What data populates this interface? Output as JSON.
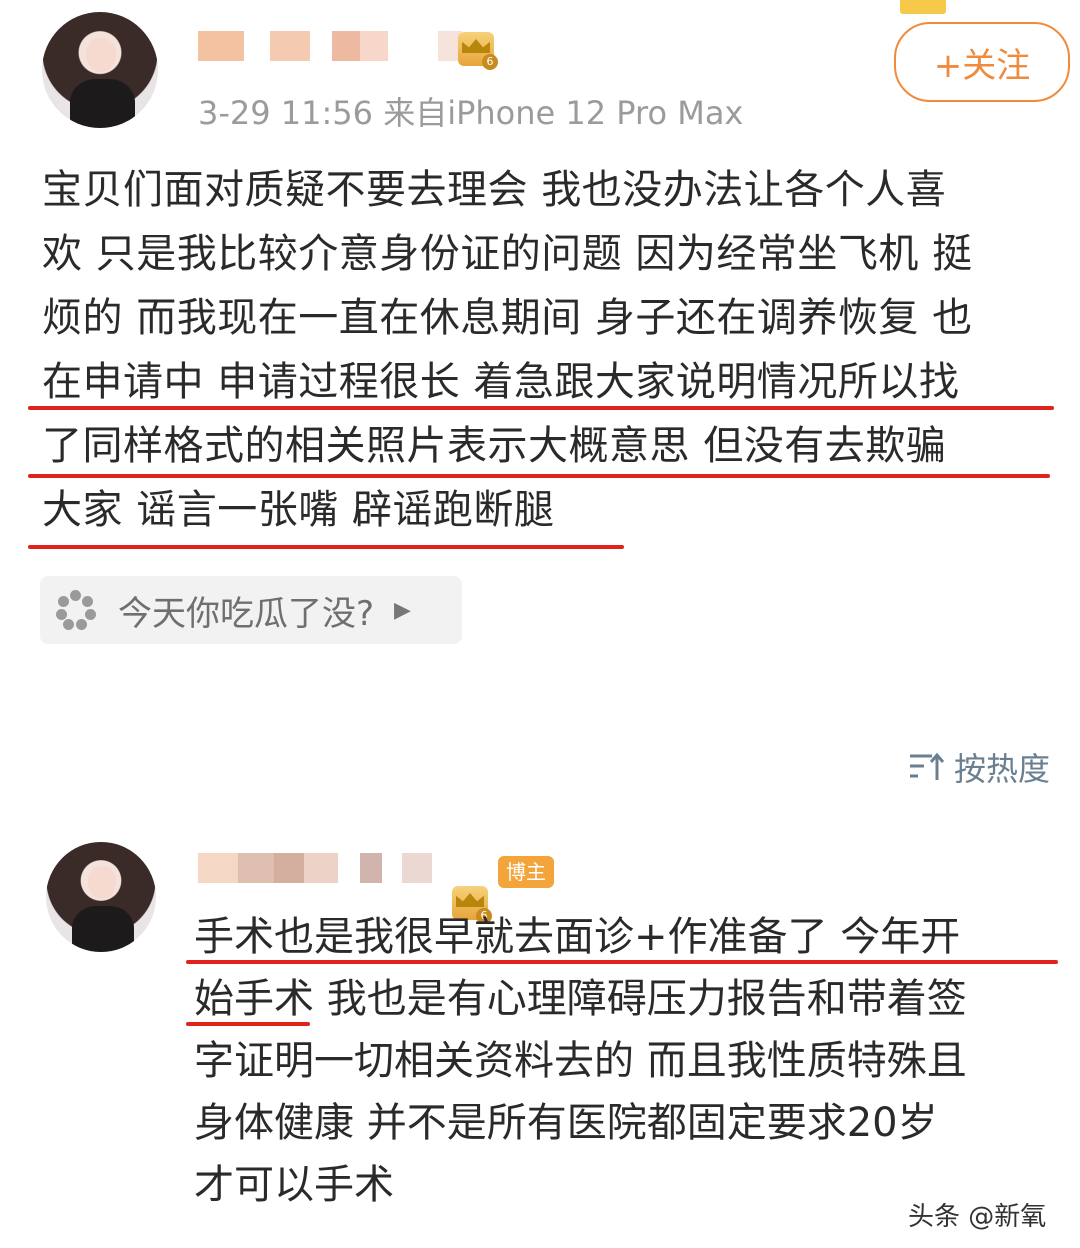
{
  "post": {
    "meta": "3-29 11:56 来自iPhone 12 Pro Max",
    "follow_label": "+关注",
    "lines": [
      "宝贝们面对质疑不要去理会 我也没办法让各个人喜",
      "欢 只是我比较介意身份证的问题 因为经常坐飞机 挺",
      "烦的 而我现在一直在休息期间 身子还在调养恢复 也",
      "在申请中 申请过程很长 着急跟大家说明情况所以找",
      "了同样格式的相关照片表示大概意思 但没有去欺骗",
      "大家  谣言一张嘴 辟谣跑断腿"
    ]
  },
  "topic": {
    "label": "今天你吃瓜了没?",
    "icon": "flower-icon"
  },
  "sort": {
    "label": "按热度",
    "icon": "sort-icon"
  },
  "comment": {
    "badge_label": "博主",
    "lines": [
      "手术也是我很早就去面诊+作准备了  今年开",
      "始手术 我也是有心理障碍压力报告和带着签",
      "字证明一切相关资料去的 而且我性质特殊且",
      "身体健康 并不是所有医院都固定要求20岁",
      "才可以手术"
    ]
  },
  "watermark": "头条 @新氧",
  "colors": {
    "accent": "#f08a3c",
    "underline": "#e0221b",
    "meta": "#9b9b9b",
    "sort": "#6a7f90"
  }
}
